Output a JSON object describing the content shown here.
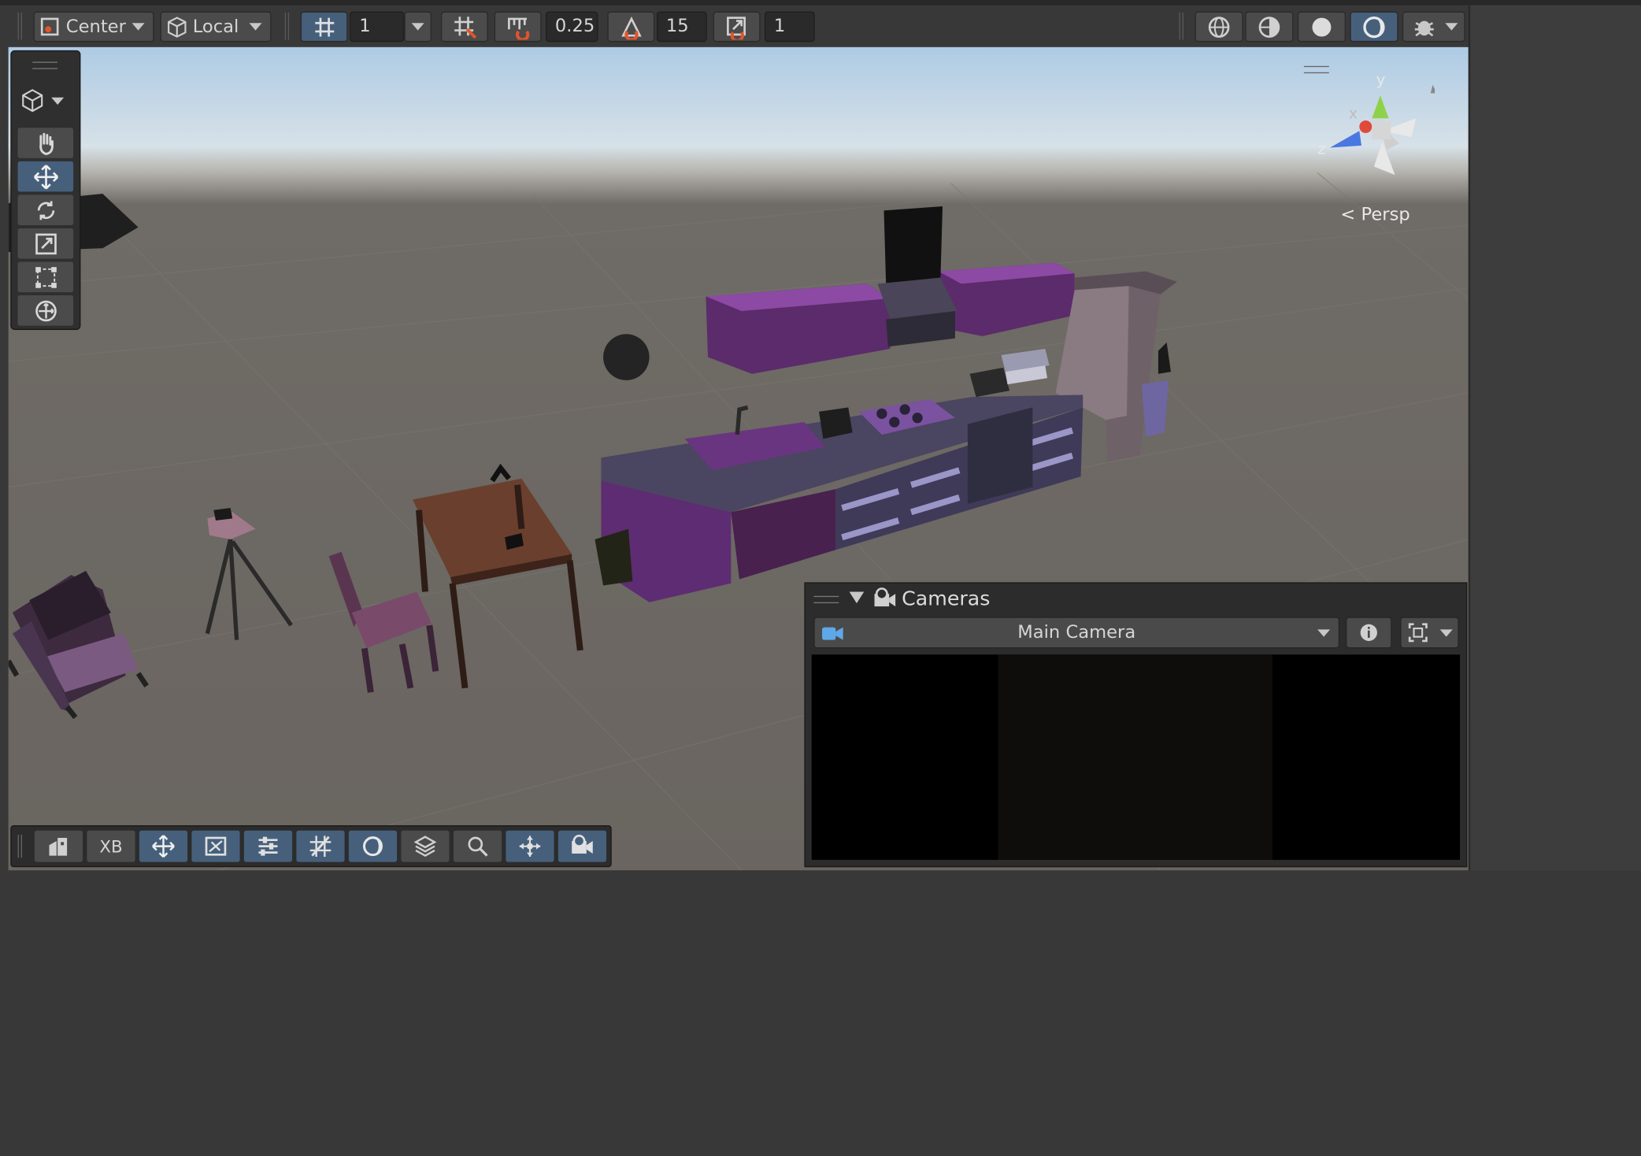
{
  "toolbar": {
    "pivot_mode": "Center",
    "pivot_rotation": "Local",
    "grid_size": "1",
    "snap_increment": "0.25",
    "rotate_snap": "15",
    "scale_snap": "1"
  },
  "gizmo": {
    "axis_y": "y",
    "axis_x": "x",
    "axis_z": "z",
    "projection": "Persp"
  },
  "cameras": {
    "title": "Cameras",
    "selected_camera": "Main Camera"
  },
  "bottom_toolbar": {
    "xb_label": "XB"
  },
  "colors": {
    "accent": "#46607c",
    "toolbar_bg": "#383838",
    "button_bg": "#4b4b4b",
    "cabinet": "#7b3f95"
  }
}
